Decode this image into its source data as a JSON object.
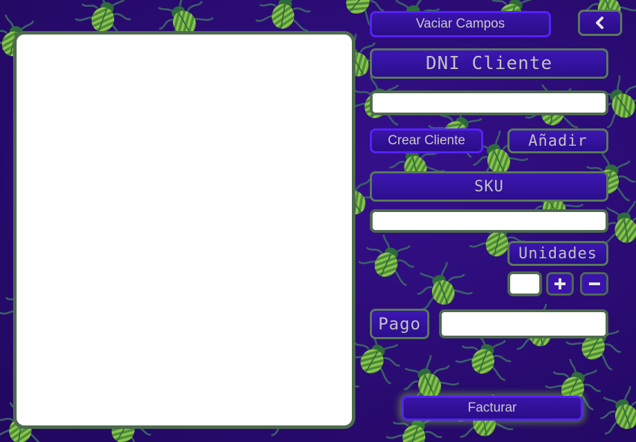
{
  "buttons": {
    "clear_fields": "Vaciar Campos",
    "create_client": "Crear Cliente",
    "add": "Añadir",
    "invoice": "Facturar"
  },
  "labels": {
    "client_id": "DNI Cliente",
    "sku": "SKU",
    "units": "Unidades",
    "payment": "Pago"
  },
  "inputs": {
    "client_id_value": "",
    "sku_value": "",
    "units_value": "",
    "payment_value": ""
  },
  "icons": {
    "back": "chevron-left-icon",
    "increment": "plus-icon",
    "decrement": "minus-icon",
    "background_pattern": "beetle-icon"
  },
  "colors": {
    "background": "#2a0a6e",
    "button_fill": "#3a14a8",
    "button_border_blue": "#5522ff",
    "border_green": "#4f6b4f",
    "beetle_green": "#4e8b3a",
    "beetle_stripe": "#8ac54a",
    "text": "#c9c9c9"
  }
}
